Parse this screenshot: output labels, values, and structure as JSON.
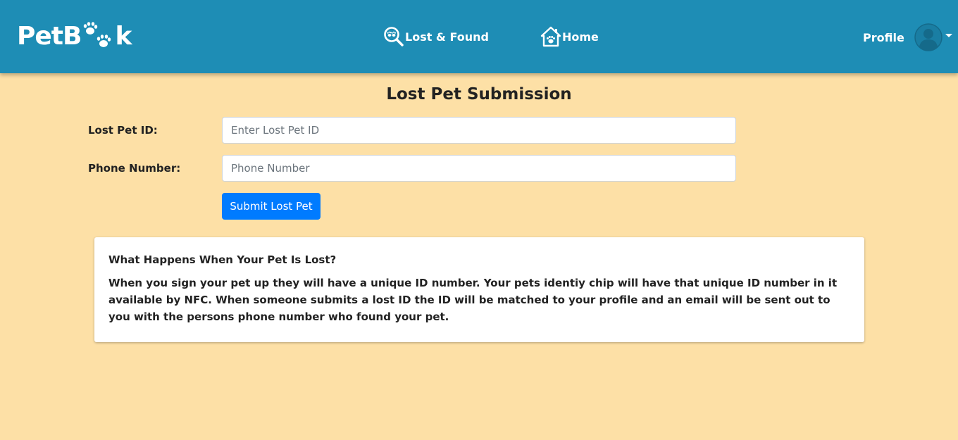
{
  "brand": {
    "logo_prefix": "PetB",
    "logo_suffix": "k",
    "color": "#1e8db5"
  },
  "nav": {
    "lost_found_label": "Lost & Found",
    "lost_found_icon": "magnifier-paw-icon",
    "home_label": "Home",
    "home_icon": "house-paw-icon",
    "profile_label": "Profile",
    "profile_icon": "avatar-icon"
  },
  "form": {
    "title": "Lost Pet Submission",
    "pet_id_label": "Lost Pet ID:",
    "pet_id_placeholder": "Enter Lost Pet ID",
    "pet_id_value": "",
    "phone_label": "Phone Number:",
    "phone_placeholder": "Phone Number",
    "phone_value": "",
    "submit_label": "Submit Lost Pet",
    "submit_color": "#007bff"
  },
  "info": {
    "title": "What Happens When Your Pet Is Lost?",
    "body": "When you sign your pet up they will have a unique ID number. Your pets identiy chip will have that unique ID number in it available by NFC. When someone submits a lost ID the ID will be matched to your profile and an email will be sent out to you with the persons phone number who found your pet."
  },
  "page": {
    "background": "#fde0a6"
  }
}
